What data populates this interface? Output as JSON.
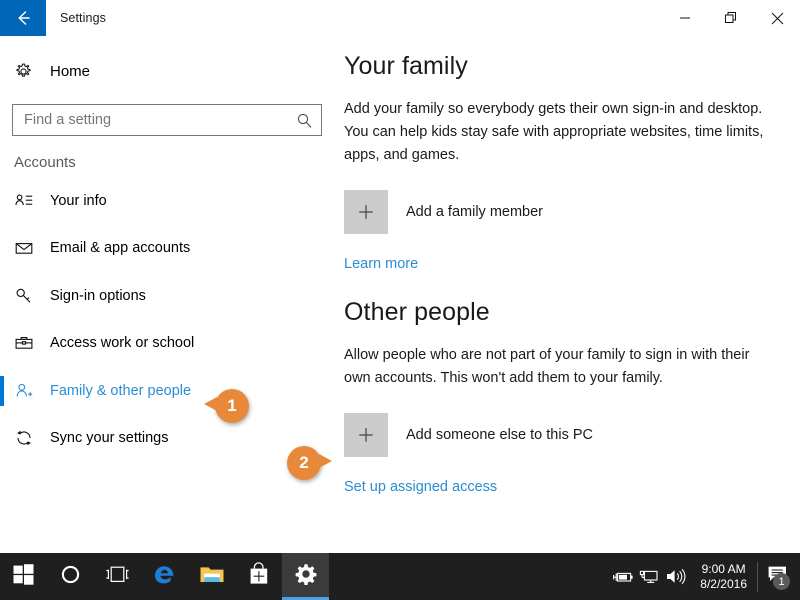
{
  "window": {
    "title": "Settings",
    "back_icon": "back-arrow-icon",
    "minimize_label": "Minimize",
    "restore_label": "Restore",
    "close_label": "Close",
    "accent_color": "#0067b8"
  },
  "sidebar": {
    "home": {
      "label": "Home",
      "icon": "gear-icon"
    },
    "search": {
      "placeholder": "Find a setting",
      "value": "",
      "icon": "search-icon"
    },
    "group_title": "Accounts",
    "selected_index": 4,
    "items": [
      {
        "label": "Your info",
        "icon": "contact-card-icon"
      },
      {
        "label": "Email & app accounts",
        "icon": "envelope-icon"
      },
      {
        "label": "Sign-in options",
        "icon": "key-icon"
      },
      {
        "label": "Access work or school",
        "icon": "briefcase-icon"
      },
      {
        "label": "Family & other people",
        "icon": "person-add-icon"
      },
      {
        "label": "Sync your settings",
        "icon": "sync-icon"
      }
    ],
    "selected_color": "#2a8dd4",
    "accent_bar_color": "#0078d7"
  },
  "content": {
    "family": {
      "heading": "Your family",
      "description": "Add your family so everybody gets their own sign-in and desktop. You can help kids stay safe with appropriate websites, time limits, apps, and games.",
      "add_tile_label": "Add a family member",
      "add_tile_icon": "plus-icon",
      "link": "Learn more"
    },
    "other_people": {
      "heading": "Other people",
      "description": "Allow people who are not part of your family to sign in with their own accounts. This won't add them to your family.",
      "add_tile_label": "Add someone else to this PC",
      "add_tile_icon": "plus-icon",
      "link": "Set up assigned access"
    },
    "link_color": "#2a8dd4"
  },
  "callouts": {
    "color": "#e8883a",
    "items": [
      {
        "number": "1",
        "points": "left",
        "target": "Family & other people"
      },
      {
        "number": "2",
        "points": "right",
        "target": "Add someone else to this PC"
      }
    ]
  },
  "taskbar": {
    "background": "#1f1f1f",
    "buttons": [
      {
        "name": "start-button",
        "icon": "windows-logo-icon",
        "label": "Start",
        "active": false
      },
      {
        "name": "cortana-button",
        "icon": "circle-icon",
        "label": "Cortana",
        "active": false
      },
      {
        "name": "task-view-button",
        "icon": "task-view-icon",
        "label": "Task View",
        "active": false
      },
      {
        "name": "edge-button",
        "icon": "edge-icon",
        "label": "Microsoft Edge",
        "active": false
      },
      {
        "name": "file-explorer-button",
        "icon": "folder-icon",
        "label": "File Explorer",
        "active": false
      },
      {
        "name": "store-button",
        "icon": "store-bag-icon",
        "label": "Microsoft Store",
        "active": false
      },
      {
        "name": "settings-button",
        "icon": "gear-icon",
        "label": "Settings",
        "active": true
      }
    ],
    "tray": {
      "icons": [
        {
          "name": "battery-charging-icon",
          "label": "Battery"
        },
        {
          "name": "network-monitor-icon",
          "label": "Network"
        },
        {
          "name": "volume-icon",
          "label": "Volume"
        }
      ],
      "time": "9:00 AM",
      "date": "8/2/2016",
      "action_center": {
        "icon": "speech-bubble-icon",
        "badge": "1",
        "label": "Action Center"
      }
    },
    "active_underline_color": "#4aa3e8"
  }
}
